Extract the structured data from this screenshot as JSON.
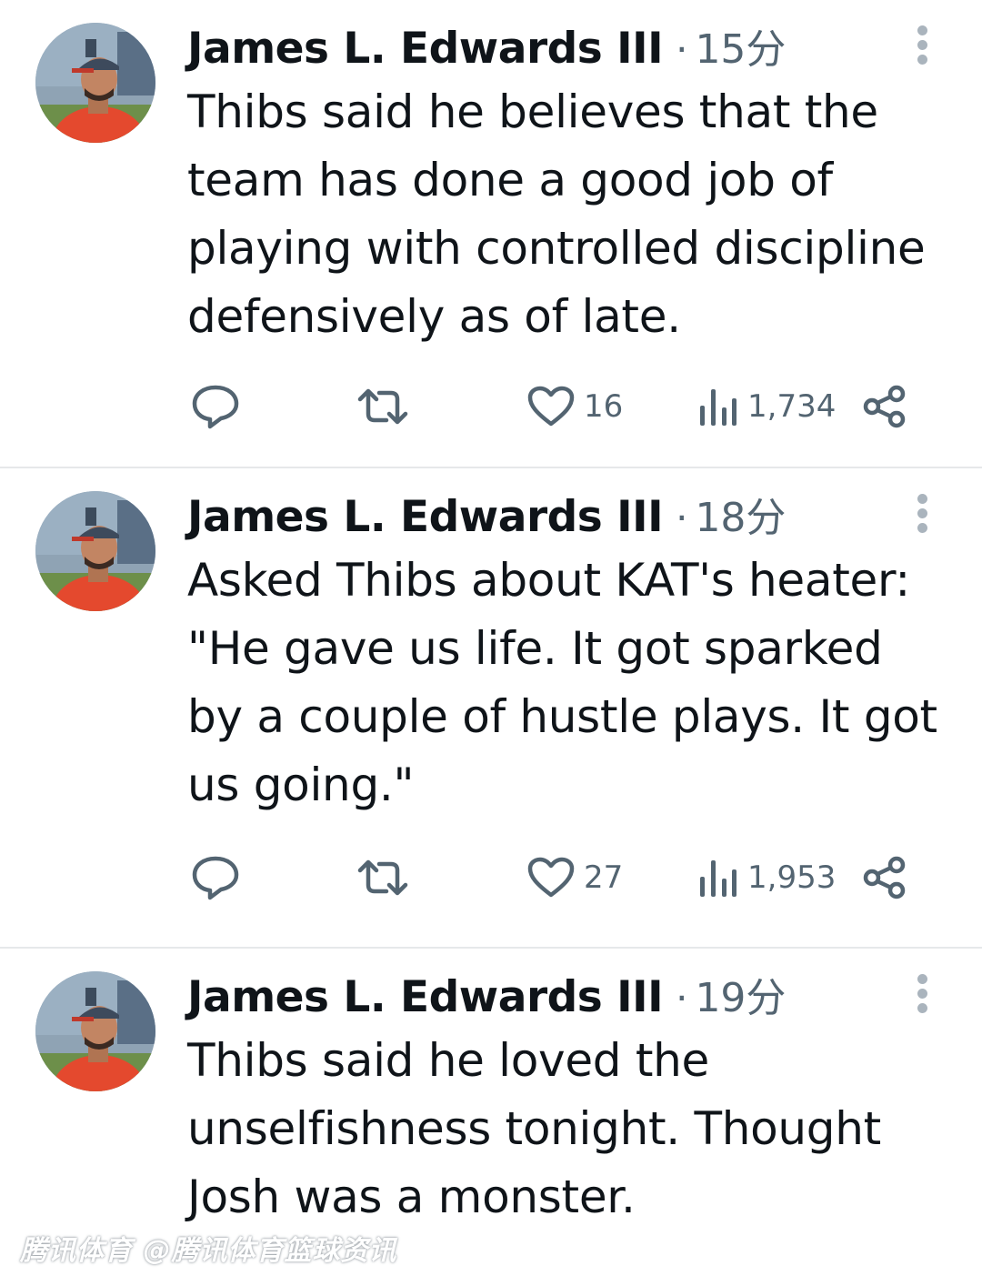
{
  "tweets": [
    {
      "author": "James L. Edwards III",
      "separator": "·",
      "time": "15分",
      "text": "Thibs said he believes that the team has done a good job of playing with controlled discipline defensively as of late.",
      "likes": "16",
      "views": "1,734"
    },
    {
      "author": "James L. Edwards III",
      "separator": "·",
      "time": "18分",
      "text": "Asked Thibs about KAT's heater: \"He gave us life. It got sparked by a couple of hustle plays. It got us going.\"",
      "likes": "27",
      "views": "1,953"
    },
    {
      "author": "James L. Edwards III",
      "separator": "·",
      "time": "19分",
      "text": "Thibs said he loved the unselfishness tonight. Thought Josh was a monster."
    }
  ],
  "icons": {
    "reply": "reply-icon",
    "retweet": "retweet-icon",
    "like": "heart-icon",
    "views": "views-icon",
    "share": "share-icon",
    "more": "more-icon"
  },
  "colors": {
    "text": "#0f1419",
    "muted": "#536471",
    "divider": "#e6e8ea"
  },
  "watermark": "腾讯体育 @腾讯体育篮球资讯"
}
